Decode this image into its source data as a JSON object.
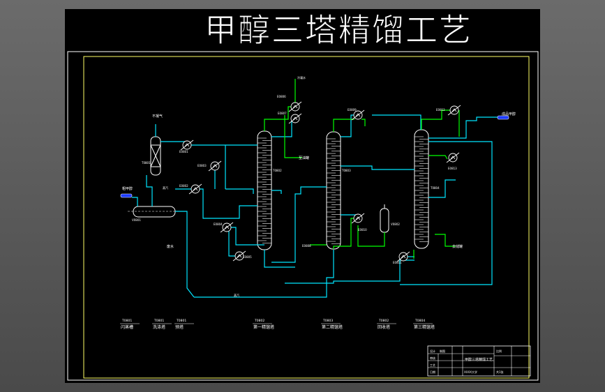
{
  "title": "甲醇三塔精馏工艺",
  "labels": {
    "feed_in": "粗甲醇",
    "product_out": "成品甲醇",
    "waste_water": "废水",
    "to_tank": "至油罐",
    "to_tank2": "去储罐",
    "top_gas": "不凝气",
    "t0801": "T0801",
    "t0802": "T0802",
    "t0803": "T0803",
    "t0804": "T0804",
    "e0801": "E0801",
    "e0802": "E0802",
    "e0803": "E0803",
    "e0804": "E0804",
    "e0805": "E0805",
    "e0806": "E0806",
    "e0807": "E0807",
    "e0808": "E0808",
    "e0809": "E0809",
    "e0810": "E0810",
    "e0811": "E0811",
    "e0812": "E0812",
    "e0813": "E0813",
    "v0801": "V0801",
    "v0802": "V0802",
    "steam": "蒸汽",
    "cond": "冷凝水"
  },
  "legend": [
    {
      "tag": "T0801",
      "name": "闪蒸槽"
    },
    {
      "tag": "T0801",
      "name": "洗涤塔"
    },
    {
      "tag": "T0801",
      "name": "预塔"
    },
    {
      "tag": "T0802",
      "name": "第一精馏塔"
    },
    {
      "tag": "T0803",
      "name": "第二精馏塔"
    },
    {
      "tag": "T0802",
      "name": "回收塔"
    },
    {
      "tag": "T0804",
      "name": "第三精馏塔"
    }
  ],
  "title_block": {
    "r1": [
      "设计",
      "制图"
    ],
    "r2": [
      "审核"
    ],
    "r3": [
      "工艺"
    ],
    "r4": [
      "日期"
    ],
    "drawing_name": "甲醇三塔精馏工艺",
    "school": "XXXX大学",
    "ratio": "比例",
    "sheet": "共1张"
  },
  "colors": {
    "canvas": "#000000",
    "border": "#ffff66",
    "cyan": "#00e5ff",
    "green": "#00ff00",
    "white": "#ffffff",
    "blue": "#1e3cff"
  }
}
